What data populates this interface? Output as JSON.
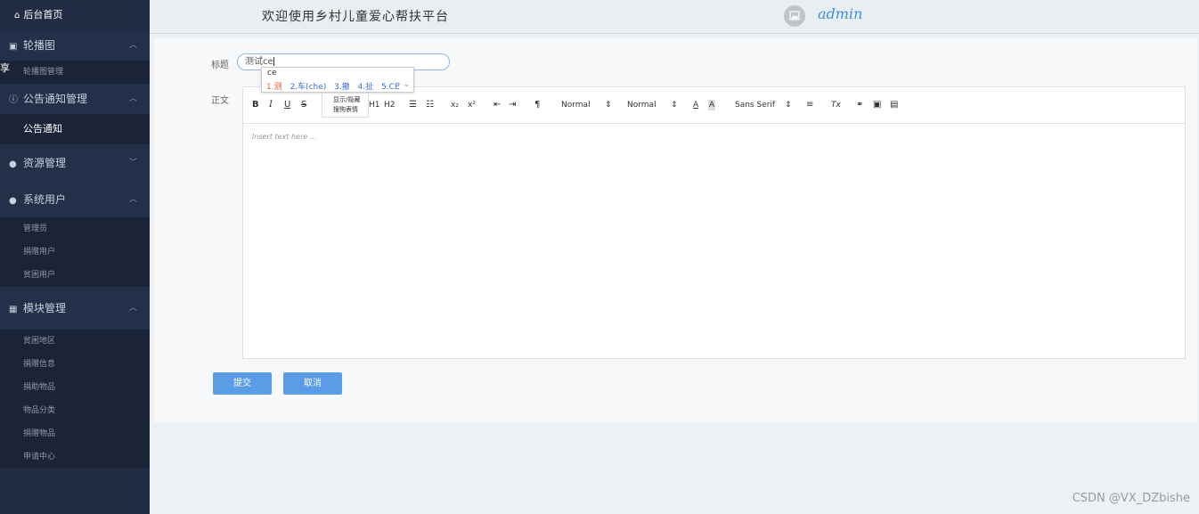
{
  "sidebar": {
    "home": "后台首页",
    "groups": [
      {
        "label": "轮播图",
        "items": [
          "轮播图管理"
        ]
      },
      {
        "label": "公告通知管理",
        "items": [
          "公告通知"
        ]
      },
      {
        "label": "资源管理",
        "items": []
      },
      {
        "label": "系统用户",
        "items": [
          "管理员",
          "捐赠用户",
          "贫困用户"
        ]
      },
      {
        "label": "模块管理",
        "items": [
          "贫困地区",
          "捐赠信息",
          "捐助物品",
          "物品分类",
          "捐赠物品",
          "申请中心"
        ]
      }
    ],
    "edge_glyph": "享"
  },
  "header": {
    "title": "欢迎使用乡村儿童爱心帮扶平台",
    "user": "admin"
  },
  "form": {
    "title_label": "标题",
    "title_value": "测试ce",
    "body_label": "正文",
    "placeholder": "Insert text here ...",
    "submit": "提交",
    "cancel": "取消"
  },
  "ime": {
    "composition": "ce",
    "candidates": [
      "1.测",
      "2.车(che)",
      "3.撤",
      "4.扯",
      "5.CE"
    ],
    "tip_line1": "显示/隐藏",
    "tip_line2": "搜狗表情"
  },
  "toolbar": {
    "bold": "B",
    "italic": "I",
    "underline": "U",
    "strike": "S",
    "h1": "H1",
    "h2": "H2",
    "sub": "x₂",
    "sup": "x²",
    "size": "Normal",
    "header": "Normal",
    "font": "Sans Serif",
    "clean": "Tx"
  },
  "watermark": "CSDN @VX_DZbishe"
}
